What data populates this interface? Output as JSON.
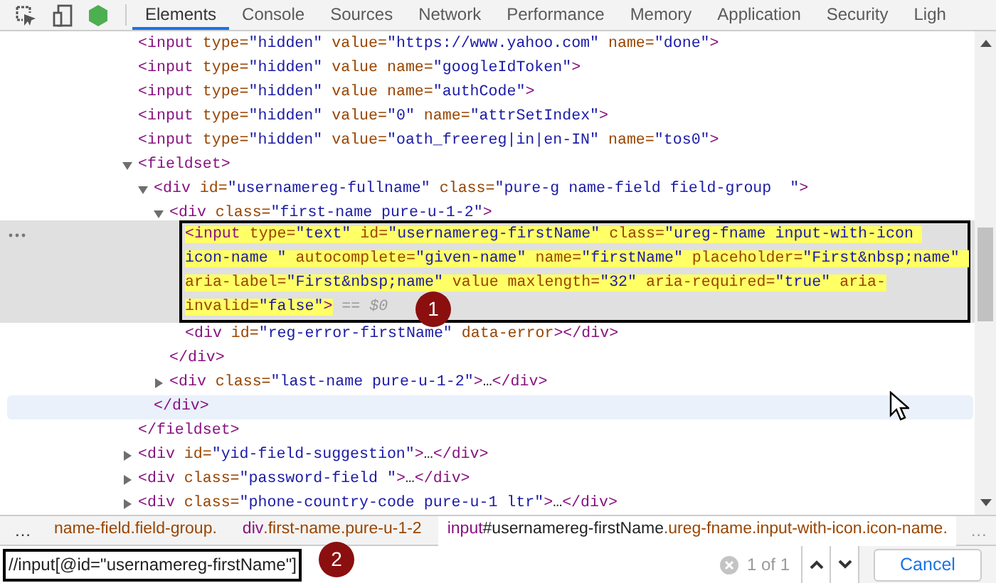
{
  "toolbar": {
    "tabs": [
      {
        "label": "Elements",
        "selected": true
      },
      {
        "label": "Console",
        "selected": false
      },
      {
        "label": "Sources",
        "selected": false
      },
      {
        "label": "Network",
        "selected": false
      },
      {
        "label": "Performance",
        "selected": false
      },
      {
        "label": "Memory",
        "selected": false
      },
      {
        "label": "Application",
        "selected": false
      },
      {
        "label": "Security",
        "selected": false
      },
      {
        "label": "Ligh",
        "selected": false
      }
    ]
  },
  "dom_tree": [
    {
      "selected": false,
      "tokens": [
        {
          "kind": "tag",
          "text": "<input"
        },
        {
          "kind": "attr",
          "text": " type="
        },
        {
          "kind": "value",
          "text": "\"hidden\""
        },
        {
          "kind": "attr",
          "text": " value="
        },
        {
          "kind": "value",
          "text": "\"https://www.yahoo.com\""
        },
        {
          "kind": "attr",
          "text": " name="
        },
        {
          "kind": "value",
          "text": "\"done\""
        },
        {
          "kind": "tag",
          "text": ">"
        }
      ]
    },
    {
      "selected": false,
      "tokens": [
        {
          "kind": "tag",
          "text": "<input"
        },
        {
          "kind": "attr",
          "text": " type="
        },
        {
          "kind": "value",
          "text": "\"hidden\""
        },
        {
          "kind": "attr",
          "text": " value name="
        },
        {
          "kind": "value",
          "text": "\"googleIdToken\""
        },
        {
          "kind": "tag",
          "text": ">"
        }
      ]
    },
    {
      "selected": false,
      "tokens": [
        {
          "kind": "tag",
          "text": "<input"
        },
        {
          "kind": "attr",
          "text": " type="
        },
        {
          "kind": "value",
          "text": "\"hidden\""
        },
        {
          "kind": "attr",
          "text": " value name="
        },
        {
          "kind": "value",
          "text": "\"authCode\""
        },
        {
          "kind": "tag",
          "text": ">"
        }
      ]
    },
    {
      "selected": false,
      "tokens": [
        {
          "kind": "tag",
          "text": "<input"
        },
        {
          "kind": "attr",
          "text": " type="
        },
        {
          "kind": "value",
          "text": "\"hidden\""
        },
        {
          "kind": "attr",
          "text": " value="
        },
        {
          "kind": "value",
          "text": "\"0\""
        },
        {
          "kind": "attr",
          "text": " name="
        },
        {
          "kind": "value",
          "text": "\"attrSetIndex\""
        },
        {
          "kind": "tag",
          "text": ">"
        }
      ]
    },
    {
      "selected": false,
      "tokens": [
        {
          "kind": "tag",
          "text": "<input"
        },
        {
          "kind": "attr",
          "text": " type="
        },
        {
          "kind": "value",
          "text": "\"hidden\""
        },
        {
          "kind": "attr",
          "text": " value="
        },
        {
          "kind": "value",
          "text": "\"oath_freereg|in|en-IN\""
        },
        {
          "kind": "attr",
          "text": " name="
        },
        {
          "kind": "value",
          "text": "\"tos0\""
        },
        {
          "kind": "tag",
          "text": ">"
        }
      ]
    },
    {
      "selected": false,
      "expanded": true,
      "tokens": [
        {
          "kind": "tag",
          "text": "<fieldset>"
        }
      ],
      "closing": {
        "hovered": false,
        "tokens": [
          {
            "kind": "tag",
            "text": "</fieldset>"
          }
        ]
      },
      "children": [
        {
          "selected": false,
          "expanded": true,
          "tokens": [
            {
              "kind": "tag",
              "text": "<div"
            },
            {
              "kind": "attr",
              "text": " id="
            },
            {
              "kind": "value",
              "text": "\"usernamereg-fullname\""
            },
            {
              "kind": "attr",
              "text": " class="
            },
            {
              "kind": "value",
              "text": "\"pure-g name-field field-group  \""
            },
            {
              "kind": "tag",
              "text": ">"
            }
          ],
          "closing": {
            "hovered": true,
            "tokens": [
              {
                "kind": "tag",
                "text": "</div>"
              }
            ]
          },
          "children": [
            {
              "selected": false,
              "expanded": true,
              "tokens": [
                {
                  "kind": "tag",
                  "text": "<div"
                },
                {
                  "kind": "attr",
                  "text": " class="
                },
                {
                  "kind": "value",
                  "text": "\"first-name pure-u-1-2\""
                },
                {
                  "kind": "tag",
                  "text": ">"
                }
              ],
              "closing": {
                "hovered": false,
                "tokens": [
                  {
                    "kind": "tag",
                    "text": "</div>"
                  }
                ]
              },
              "children": [
                {
                  "selected": true,
                  "tokens": [
                    {
                      "kind": "tag",
                      "text": "<input"
                    },
                    {
                      "kind": "attr",
                      "text": " type="
                    },
                    {
                      "kind": "value",
                      "text": "\"text\""
                    },
                    {
                      "kind": "attr",
                      "text": " id="
                    },
                    {
                      "kind": "value",
                      "text": "\"usernamereg-firstName\""
                    },
                    {
                      "kind": "attr",
                      "text": " class="
                    },
                    {
                      "kind": "value",
                      "text": "\"ureg-fname input-with-icon icon-name \""
                    },
                    {
                      "kind": "attr",
                      "text": " autocomplete="
                    },
                    {
                      "kind": "value",
                      "text": "\"given-name\""
                    },
                    {
                      "kind": "attr",
                      "text": " name="
                    },
                    {
                      "kind": "value",
                      "text": "\"firstName\""
                    },
                    {
                      "kind": "attr",
                      "text": " placeholder="
                    },
                    {
                      "kind": "value",
                      "text": "\"First&nbsp;name\""
                    },
                    {
                      "kind": "attr",
                      "text": " aria-label="
                    },
                    {
                      "kind": "value",
                      "text": "\"First&nbsp;name\""
                    },
                    {
                      "kind": "attr",
                      "text": " value maxlength="
                    },
                    {
                      "kind": "value",
                      "text": "\"32\""
                    },
                    {
                      "kind": "attr",
                      "text": " aria-required="
                    },
                    {
                      "kind": "value",
                      "text": "\"true\""
                    },
                    {
                      "kind": "attr",
                      "text": " aria-invalid="
                    },
                    {
                      "kind": "value",
                      "text": "\"false\""
                    },
                    {
                      "kind": "tag",
                      "text": ">"
                    },
                    {
                      "kind": "dim",
                      "text": " == $0"
                    }
                  ]
                },
                {
                  "selected": false,
                  "tokens": [
                    {
                      "kind": "tag",
                      "text": "<div"
                    },
                    {
                      "kind": "attr",
                      "text": " id="
                    },
                    {
                      "kind": "value",
                      "text": "\"reg-error-firstName\""
                    },
                    {
                      "kind": "attr",
                      "text": " data-error"
                    },
                    {
                      "kind": "tag",
                      "text": "></div>"
                    }
                  ]
                }
              ]
            },
            {
              "selected": false,
              "expanded": false,
              "tokens": [
                {
                  "kind": "tag",
                  "text": "<div"
                },
                {
                  "kind": "attr",
                  "text": " class="
                },
                {
                  "kind": "value",
                  "text": "\"last-name pure-u-1-2\""
                },
                {
                  "kind": "tag",
                  "text": ">"
                },
                {
                  "kind": "text",
                  "text": "…"
                },
                {
                  "kind": "tag",
                  "text": "</div>"
                }
              ]
            }
          ]
        }
      ]
    },
    {
      "selected": false,
      "expanded": false,
      "tokens": [
        {
          "kind": "tag",
          "text": "<div"
        },
        {
          "kind": "attr",
          "text": " id="
        },
        {
          "kind": "value",
          "text": "\"yid-field-suggestion\""
        },
        {
          "kind": "tag",
          "text": ">"
        },
        {
          "kind": "text",
          "text": "…"
        },
        {
          "kind": "tag",
          "text": "</div>"
        }
      ]
    },
    {
      "selected": false,
      "expanded": false,
      "tokens": [
        {
          "kind": "tag",
          "text": "<div"
        },
        {
          "kind": "attr",
          "text": " class="
        },
        {
          "kind": "value",
          "text": "\"password-field \""
        },
        {
          "kind": "tag",
          "text": ">"
        },
        {
          "kind": "text",
          "text": "…"
        },
        {
          "kind": "tag",
          "text": "</div>"
        }
      ]
    },
    {
      "selected": false,
      "expanded": false,
      "tokens": [
        {
          "kind": "tag",
          "text": "<div"
        },
        {
          "kind": "attr",
          "text": " class="
        },
        {
          "kind": "value",
          "text": "\"phone-country-code pure-u-1 ltr\""
        },
        {
          "kind": "tag",
          "text": ">"
        },
        {
          "kind": "text",
          "text": "…"
        },
        {
          "kind": "tag",
          "text": "</div>"
        }
      ]
    }
  ],
  "breadcrumbs": {
    "lead": "…",
    "items": [
      {
        "selected": false,
        "tokens": [
          {
            "kind": "attr",
            "text": "name-field.field-group."
          }
        ]
      },
      {
        "selected": false,
        "tokens": [
          {
            "kind": "tag",
            "text": "div"
          },
          {
            "kind": "attr",
            "text": ".first-name.pure-u-1-2"
          }
        ]
      },
      {
        "selected": true,
        "tokens": [
          {
            "kind": "tag",
            "text": "input"
          },
          {
            "kind": "text",
            "text": "#usernamereg-firstName"
          },
          {
            "kind": "attr",
            "text": ".ureg-fname.input-with-icon.icon-name."
          }
        ]
      }
    ],
    "trail": "…"
  },
  "search": {
    "value": "//input[@id=\"usernamereg-firstName\"]",
    "match_count": "1 of 1",
    "cancel": "Cancel"
  },
  "callouts": [
    {
      "label": "1"
    },
    {
      "label": "2"
    }
  ]
}
